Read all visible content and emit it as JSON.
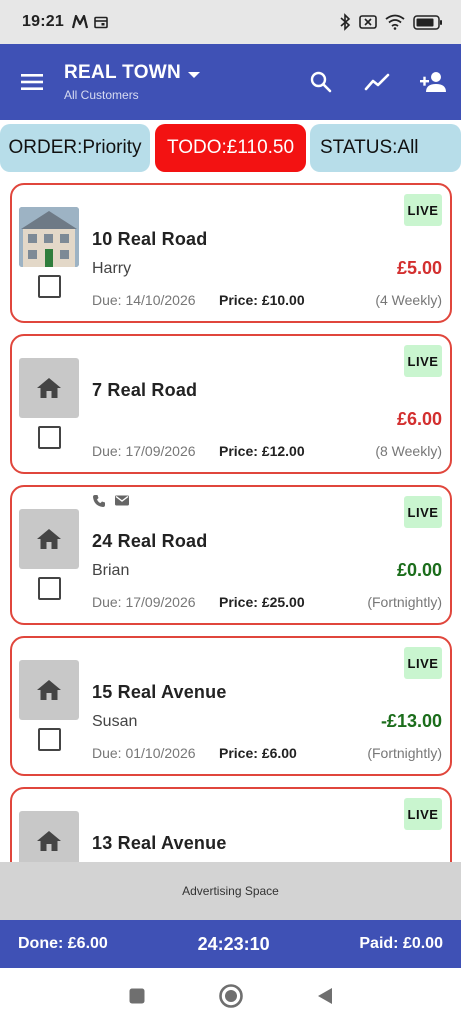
{
  "status_bar": {
    "time": "19:21"
  },
  "app_bar": {
    "title": "REAL TOWN",
    "subtitle": "All Customers"
  },
  "filters": {
    "order": "ORDER:Priority",
    "todo": "TODO:£110.50",
    "status": "STATUS:All"
  },
  "cards": [
    {
      "address": "10 Real Road",
      "customer": "Harry",
      "amount": "£5.00",
      "amount_color": "red",
      "due": "Due: 14/10/2026",
      "price_label": "Price:",
      "price": "£10.00",
      "frequency": "(4 Weekly)",
      "badge": "LIVE",
      "has_photo": true,
      "contact": false
    },
    {
      "address": "7 Real Road",
      "customer": "",
      "amount": "£6.00",
      "amount_color": "red",
      "due": "Due: 17/09/2026",
      "price_label": "Price:",
      "price": "£12.00",
      "frequency": "(8 Weekly)",
      "badge": "LIVE",
      "has_photo": false,
      "contact": false
    },
    {
      "address": "24 Real Road",
      "customer": "Brian",
      "amount": "£0.00",
      "amount_color": "green",
      "due": "Due: 17/09/2026",
      "price_label": "Price:",
      "price": "£25.00",
      "frequency": "(Fortnightly)",
      "badge": "LIVE",
      "has_photo": false,
      "contact": true
    },
    {
      "address": "15 Real Avenue",
      "customer": "Susan",
      "amount": "-£13.00",
      "amount_color": "green",
      "due": "Due: 01/10/2026",
      "price_label": "Price:",
      "price": "£6.00",
      "frequency": "(Fortnightly)",
      "badge": "LIVE",
      "has_photo": false,
      "contact": false
    },
    {
      "address": "13 Real Avenue",
      "customer": "",
      "amount": "",
      "amount_color": "red",
      "due": "",
      "price_label": "",
      "price": "",
      "frequency": "",
      "badge": "LIVE",
      "has_photo": false,
      "contact": false
    }
  ],
  "ad": {
    "text": "Advertising Space"
  },
  "footer": {
    "done": "Done: £6.00",
    "timer": "24:23:10",
    "paid": "Paid: £0.00"
  },
  "colors": {
    "primary": "#3f51b5",
    "todo": "#f31212",
    "chip": "#b7dde9",
    "card_border": "#e0463c",
    "live_bg": "#c9f5cf",
    "negative": "#d32f2f",
    "positive": "#1b6d1b"
  },
  "icons": {
    "menu": "menu-icon",
    "dropdown": "dropdown-arrow-icon",
    "search": "search-icon",
    "stats": "trend-icon",
    "add_person": "person-add-icon",
    "home": "home-icon",
    "phone": "phone-icon",
    "email": "email-icon"
  }
}
